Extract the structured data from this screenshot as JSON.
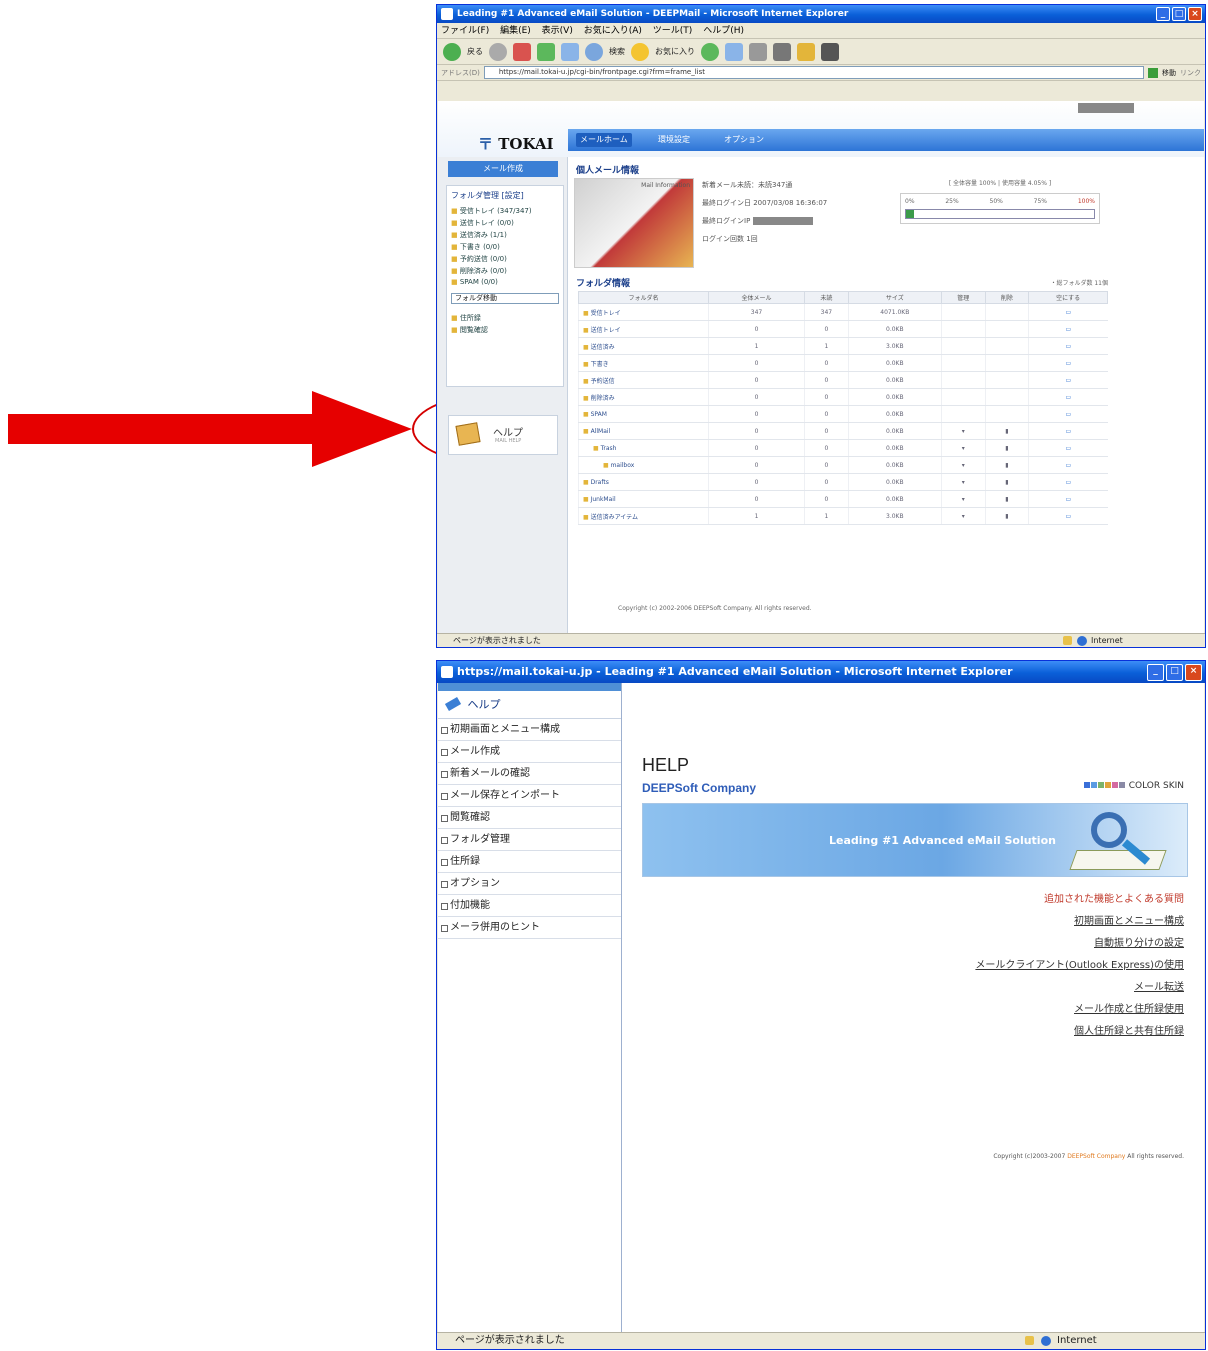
{
  "window1": {
    "title": "Leading #1 Advanced eMail Solution - DEEPMail - Microsoft Internet Explorer",
    "menu": [
      "ファイル(F)",
      "編集(E)",
      "表示(V)",
      "お気に入り(A)",
      "ツール(T)",
      "ヘルプ(H)"
    ],
    "toolbar": {
      "back": "戻る",
      "search": "検索",
      "favorites": "お気に入り"
    },
    "address_label": "アドレス(D)",
    "address": "https://mail.tokai-u.jp/cgi-bin/frontpage.cgi?frm=frame_list",
    "go_label": "移動",
    "links_label": "リンク",
    "logo": "TOKAI",
    "nav_tabs": [
      "メールホーム",
      "環境設定",
      "オプション"
    ],
    "compose_button": "メール作成",
    "folder_manage": "フォルダ管理",
    "folder_manage_btn": "[設定]",
    "folders": [
      "受信トレイ (347/347)",
      "送信トレイ (0/0)",
      "送信済み (1/1)",
      "下書き (0/0)",
      "予約送信 (0/0)",
      "削除済み (0/0)",
      "SPAM (0/0)"
    ],
    "folder_select": "フォルダ移動",
    "address_book_link": "住所録",
    "schedule_link": "閲覧確認",
    "help_label": "ヘルプ",
    "help_sub": "MAIL HELP",
    "section_personal": "個人メール情報",
    "info_image_caption": "Mail Information",
    "info_items": [
      "新着メール未読：未読347通",
      "最終ログイン日 2007/03/08 16:36:07",
      "最終ログインIP",
      "ログイン回数 1回"
    ],
    "quota_header": "[ 全体容量 100% | 使用容量 4.05% ]",
    "quota_scale": [
      "0%",
      "25%",
      "50%",
      "75%",
      "100%"
    ],
    "quota_percent": 4.05,
    "section_folder": "フォルダ情報",
    "folder_total": "・総フォルダ数 11個",
    "table_headers": [
      "フォルダ名",
      "全体メール",
      "未読",
      "サイズ",
      "管理",
      "削除",
      "空にする"
    ],
    "table_rows": [
      [
        "受信トレイ",
        "347",
        "347",
        "4071.0KB"
      ],
      [
        "送信トレイ",
        "0",
        "0",
        "0.0KB"
      ],
      [
        "送信済み",
        "1",
        "1",
        "3.0KB"
      ],
      [
        "下書き",
        "0",
        "0",
        "0.0KB"
      ],
      [
        "予約送信",
        "0",
        "0",
        "0.0KB"
      ],
      [
        "削除済み",
        "0",
        "0",
        "0.0KB"
      ],
      [
        "SPAM",
        "0",
        "0",
        "0.0KB"
      ],
      [
        "AllMail",
        "0",
        "0",
        "0.0KB"
      ],
      [
        "Trash",
        "0",
        "0",
        "0.0KB"
      ],
      [
        "mailbox",
        "0",
        "0",
        "0.0KB"
      ],
      [
        "Drafts",
        "0",
        "0",
        "0.0KB"
      ],
      [
        "JunkMail",
        "0",
        "0",
        "0.0KB"
      ],
      [
        "送信済みアイテム",
        "1",
        "1",
        "3.0KB"
      ]
    ],
    "copyright": "Copyright (c) 2002-2006 DEEPSoft Company. All rights reserved.",
    "status": "ページが表示されました",
    "zone": "Internet"
  },
  "window2": {
    "title": "https://mail.tokai-u.jp - Leading #1 Advanced eMail Solution - Microsoft Internet Explorer",
    "sidebar_head": "ヘルプ",
    "sidebar_items": [
      "初期画面とメニュー構成",
      "メール作成",
      "新着メールの確認",
      "メール保存とインポート",
      "閲覧確認",
      "フォルダ管理",
      "住所録",
      "オプション",
      "付加機能",
      "メーラ併用のヒント"
    ],
    "help_title": "HELP",
    "company": "DEEPSoft Company",
    "color_skin": "COLOR SKIN",
    "skin_colors": [
      "#3a6fd8",
      "#5a9be3",
      "#7bb36b",
      "#e0a43a",
      "#d46aa0",
      "#8a8aa6"
    ],
    "banner_slogan": "Leading #1 Advanced eMail Solution",
    "links": [
      "追加された機能とよくある質問",
      "初期画面とメニュー構成",
      "自動振り分けの設定",
      "メールクライアント(Outlook Express)の使用",
      "メール転送",
      "メール作成と住所録使用",
      "個人住所録と共有住所録"
    ],
    "copyright_prefix": "Copyright (c)2003-2007",
    "copyright_company": "DEEPSoft Company",
    "copyright_suffix": "All rights reserved.",
    "status": "ページが表示されました",
    "zone": "Internet"
  },
  "colors": {
    "arrow": "#e60000",
    "xp_blue": "#0a5fd8",
    "link_red": "#c0392b"
  }
}
